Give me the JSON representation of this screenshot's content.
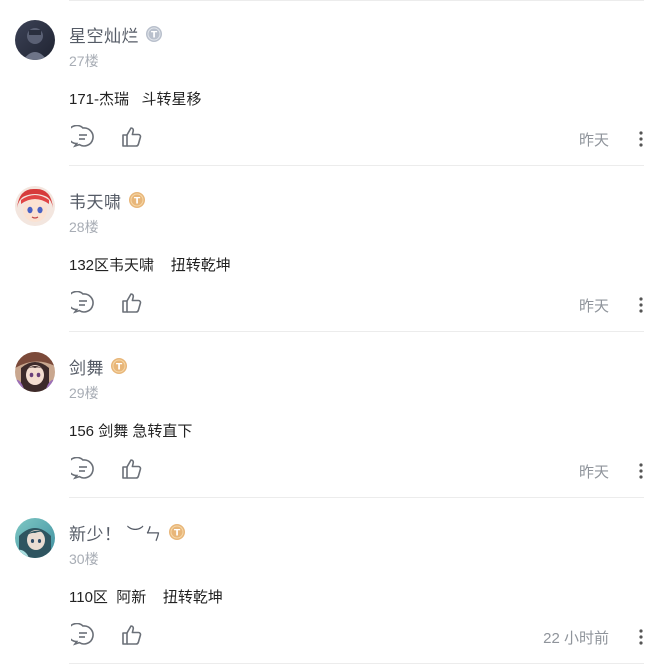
{
  "comments": [
    {
      "username": "星空灿烂",
      "badge": "gray-level-badge",
      "floor": "27楼",
      "content": "171-杰瑞   斗转星移",
      "time": "昨天",
      "avatar_desc": "dark-portrait"
    },
    {
      "username": "韦天啸",
      "badge": "gold-level-badge",
      "floor": "28楼",
      "content": "132区韦天啸    扭转乾坤",
      "time": "昨天",
      "avatar_desc": "red-hair-anime"
    },
    {
      "username": "剑舞",
      "badge": "gold-level-badge",
      "floor": "29楼",
      "content": "156 剑舞 急转直下",
      "time": "昨天",
      "avatar_desc": "anime-girl"
    },
    {
      "username": "新少！ ︶ㄣ",
      "badge": "gold-level-badge",
      "floor": "30楼",
      "content": "110区  阿新    扭转乾坤",
      "time": "22 小时前",
      "avatar_desc": "teal-anime"
    }
  ],
  "colors": {
    "gold_badge": "#e8b679",
    "gray_badge": "#b9c0cc",
    "username": "#555b66",
    "floor": "#a8adb5",
    "divider": "#ececec"
  },
  "icons": [
    "reply-icon",
    "like-icon",
    "more-icon"
  ]
}
